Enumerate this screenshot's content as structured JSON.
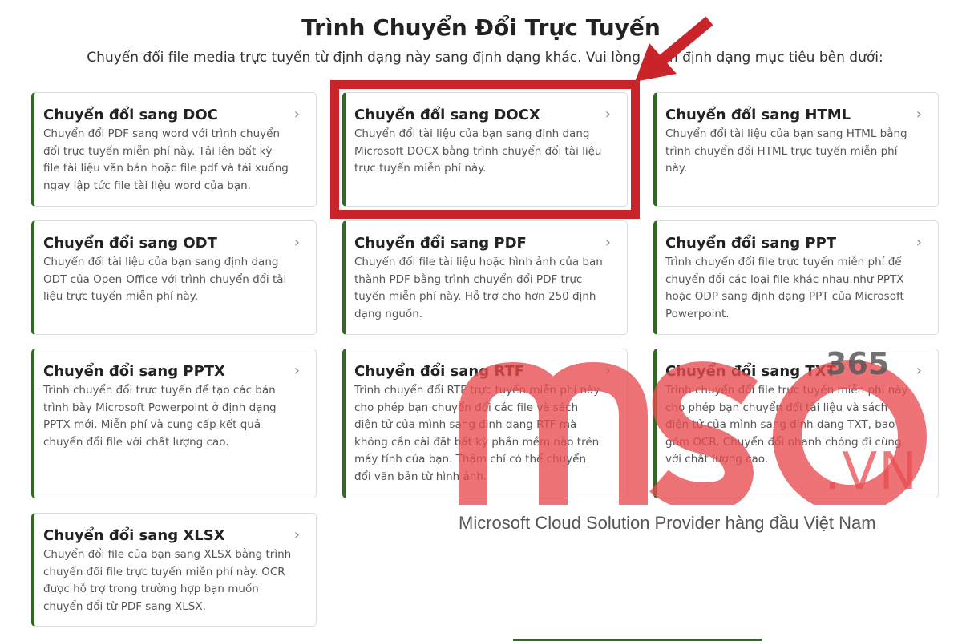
{
  "header": {
    "title": "Trình Chuyển Đổi Trực Tuyến",
    "subtitle": "Chuyển đổi file media trực tuyến từ định dạng này sang định dạng khác. Vui lòng chọn định dạng mục tiêu bên dưới:"
  },
  "cards": [
    {
      "title": "Chuyển đổi sang DOC",
      "desc": "Chuyển đổi PDF sang word với trình chuyển đổi trực tuyến miễn phí này. Tải lên bất kỳ file tài liệu văn bản hoặc file pdf và tải xuống ngay lập tức file tài liệu word của bạn."
    },
    {
      "title": "Chuyển đổi sang DOCX",
      "desc": "Chuyển đổi tài liệu của bạn sang định dạng Microsoft DOCX bằng trình chuyển đổi tài liệu trực tuyến miễn phí này."
    },
    {
      "title": "Chuyển đổi sang HTML",
      "desc": "Chuyển đổi tài liệu của bạn sang HTML bằng trình chuyển đổi HTML trực tuyến miễn phí này."
    },
    {
      "title": "Chuyển đổi sang ODT",
      "desc": "Chuyển đổi tài liệu của bạn sang định dạng ODT của Open-Office với trình chuyển đổi tài liệu trực tuyến miễn phí này."
    },
    {
      "title": "Chuyển đổi sang PDF",
      "desc": "Chuyển đổi file tài liệu hoặc hình ảnh của bạn thành PDF bằng trình chuyển đổi PDF trực tuyến miễn phí này. Hỗ trợ cho hơn 250 định dạng nguồn."
    },
    {
      "title": "Chuyển đổi sang PPT",
      "desc": "Trình chuyển đổi file trực tuyến miễn phí để chuyển đổi các loại file khác nhau như PPTX hoặc ODP sang định dạng PPT của Microsoft Powerpoint."
    },
    {
      "title": "Chuyển đổi sang PPTX",
      "desc": "Trình chuyển đổi trực tuyến để tạo các bản trình bày Microsoft Powerpoint ở định dạng PPTX mới. Miễn phí và cung cấp kết quả chuyển đổi file với chất lượng cao."
    },
    {
      "title": "Chuyển đổi sang RTF",
      "desc": "Trình chuyển đổi RTF trực tuyến miễn phí này cho phép bạn chuyển đổi các file và sách điện tử của mình sang định dạng RTF mà không cần cài đặt bất kỳ phần mềm nào trên máy tính của bạn. Thậm chí có thể chuyển đổi văn bản từ hình ảnh."
    },
    {
      "title": "Chuyển đổi sang TXT",
      "desc": "Trình chuyển đổi file trực tuyến miễn phí này cho phép bạn chuyển đổi tài liệu và sách điện tử của mình sang định dạng TXT, bao gồm OCR. Chuyển đổi nhanh chóng đi cùng với chất lượng cao."
    },
    {
      "title": "Chuyển đổi sang XLSX",
      "desc": "Chuyển đổi file của bạn sang XLSX bằng trình chuyển đổi file trực tuyến miễn phí này. OCR được hỗ trợ trong trường hợp bạn muốn chuyển đổi từ PDF sang XLSX."
    }
  ],
  "chevron": "›",
  "watermark": {
    "logo_number": "365",
    "logo_suffix": ".VN",
    "tagline": "Microsoft Cloud Solution Provider hàng đầu Việt Nam"
  },
  "colors": {
    "accent": "#2e6b1f",
    "highlight": "#c8242a",
    "watermark": "#e94b4f"
  }
}
